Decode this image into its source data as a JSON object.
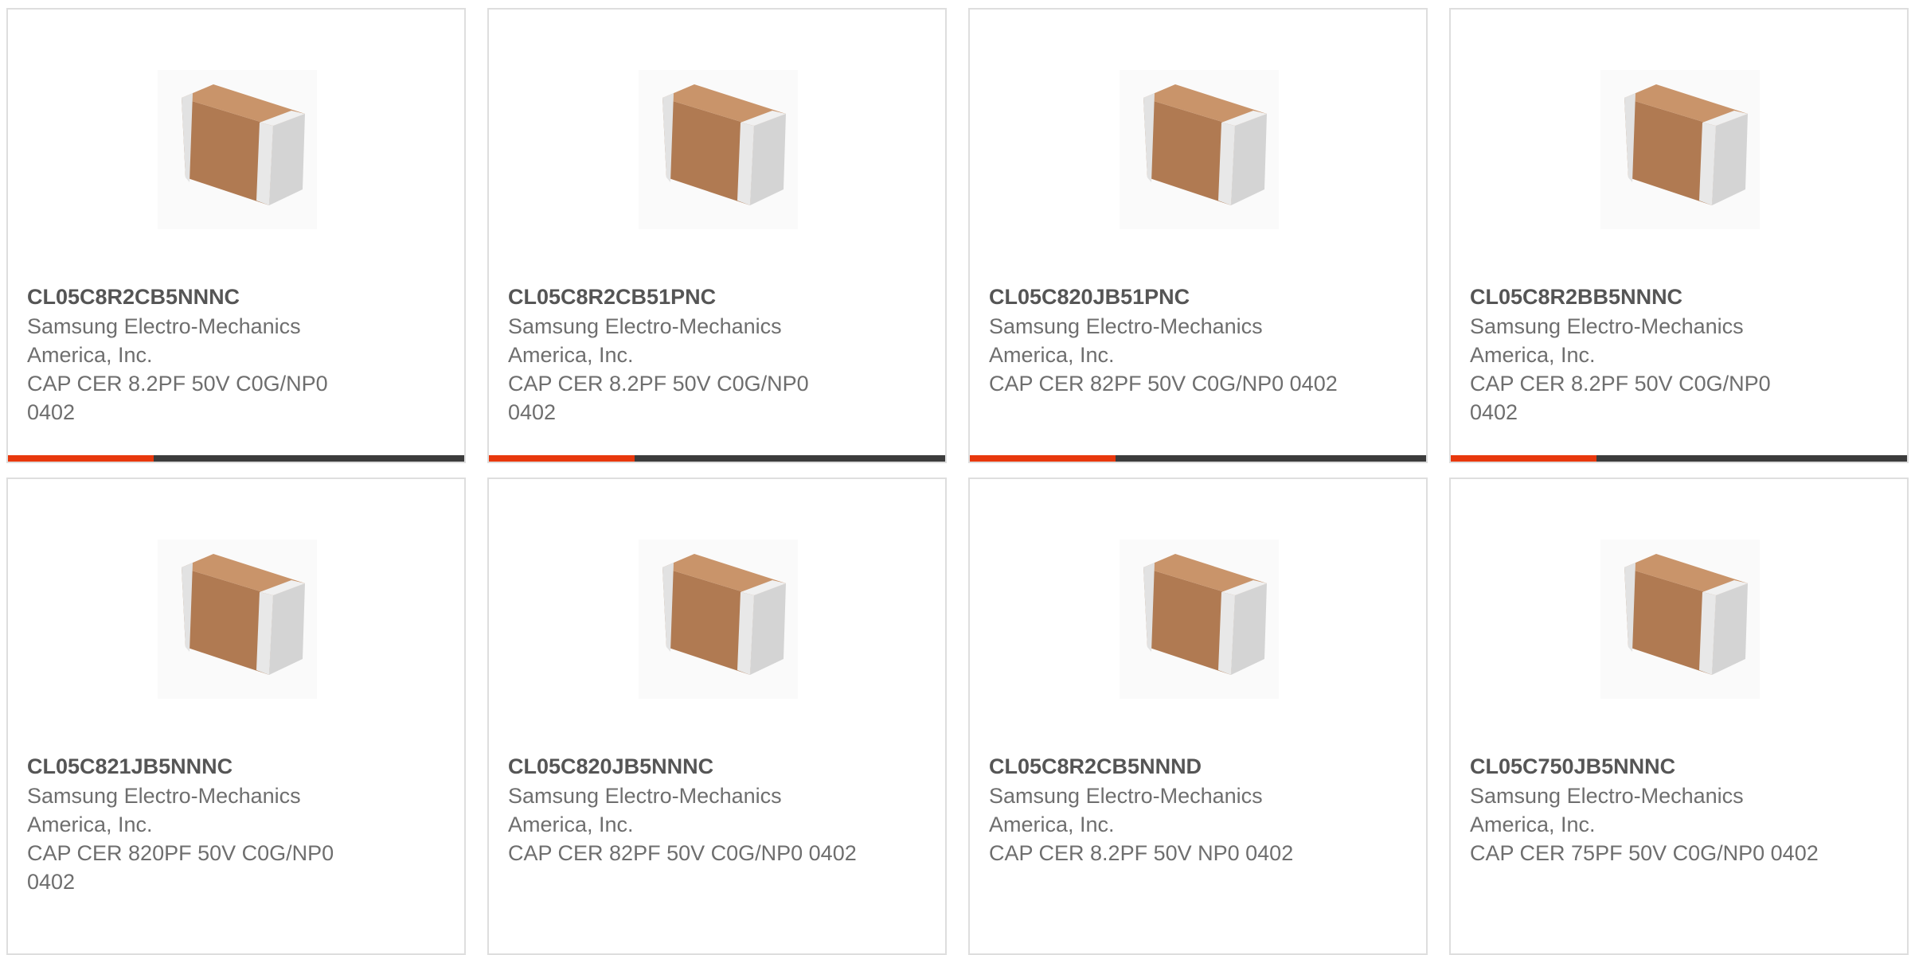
{
  "colors": {
    "accent": "#e8380d",
    "bar": "#3c3c3c",
    "border": "#dedede"
  },
  "products": [
    {
      "part": "CL05C8R2CB5NNNC",
      "manufacturer": "Samsung Electro-Mechanics America, Inc.",
      "description": "CAP CER 8.2PF 50V C0G/NP0 0402",
      "image": "ceramic-capacitor-chip-icon"
    },
    {
      "part": "CL05C8R2CB51PNC",
      "manufacturer": "Samsung Electro-Mechanics America, Inc.",
      "description": "CAP CER 8.2PF 50V C0G/NP0 0402",
      "image": "ceramic-capacitor-chip-icon"
    },
    {
      "part": "CL05C820JB51PNC",
      "manufacturer": "Samsung Electro-Mechanics America, Inc.",
      "description": "CAP CER 82PF 50V C0G/NP0 0402",
      "image": "ceramic-capacitor-chip-icon"
    },
    {
      "part": "CL05C8R2BB5NNNC",
      "manufacturer": "Samsung Electro-Mechanics America, Inc.",
      "description": "CAP CER 8.2PF 50V C0G/NP0 0402",
      "image": "ceramic-capacitor-chip-icon"
    },
    {
      "part": "CL05C821JB5NNNC",
      "manufacturer": "Samsung Electro-Mechanics America, Inc.",
      "description": "CAP CER 820PF 50V C0G/NP0 0402",
      "image": "ceramic-capacitor-chip-icon"
    },
    {
      "part": "CL05C820JB5NNNC",
      "manufacturer": "Samsung Electro-Mechanics America, Inc.",
      "description": "CAP CER 82PF 50V C0G/NP0 0402",
      "image": "ceramic-capacitor-chip-icon"
    },
    {
      "part": "CL05C8R2CB5NNND",
      "manufacturer": "Samsung Electro-Mechanics America, Inc.",
      "description": "CAP CER 8.2PF 50V NP0 0402",
      "image": "ceramic-capacitor-chip-icon"
    },
    {
      "part": "CL05C750JB5NNNC",
      "manufacturer": "Samsung Electro-Mechanics America, Inc.",
      "description": "CAP CER 75PF 50V C0G/NP0 0402",
      "image": "ceramic-capacitor-chip-icon"
    }
  ]
}
